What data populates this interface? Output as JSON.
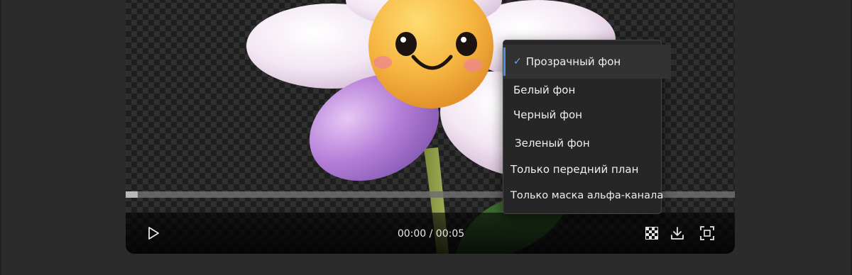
{
  "player": {
    "time_current": "00:00",
    "time_total": "00:05",
    "progress_fraction": 0.02,
    "play_icon": "play-icon",
    "bg_toggle_icon": "checkerboard-icon",
    "download_icon": "download-icon",
    "fullscreen_icon": "fullscreen-icon"
  },
  "time_display": "00:00 / 00:05",
  "background_menu": {
    "items": [
      {
        "label": "Прозрачный фон",
        "selected": true
      },
      {
        "label": "Белый фон",
        "selected": false
      },
      {
        "label": "Черный фон",
        "selected": false
      },
      {
        "label": "Зеленый фон",
        "selected": false
      },
      {
        "label": "Только передний план",
        "selected": false
      },
      {
        "label": "Только маска альфа-канала",
        "selected": false
      }
    ]
  },
  "colors": {
    "accent": "#4b8ee6",
    "menu_bg": "#262626",
    "page_bg": "#2b2b2b"
  }
}
